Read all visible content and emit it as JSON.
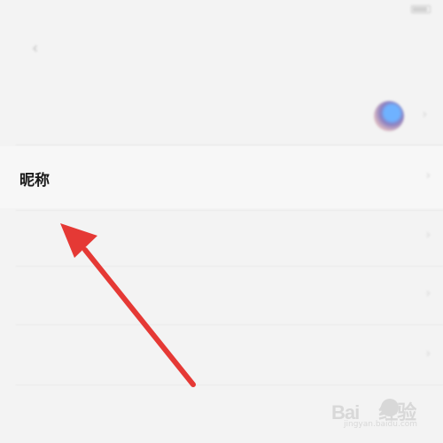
{
  "status_bar": {
    "carrier": "",
    "time": "",
    "battery_visible": true
  },
  "nav": {
    "title": "",
    "back_icon": "chevron-left-icon"
  },
  "profile": {
    "avatar_label": "",
    "nickname_label": "昵称",
    "nickname_value": "",
    "gender_label": "",
    "gender_value": "",
    "region_label": "",
    "region_value": "",
    "signature_label": "",
    "signature_value": "",
    "school_label": ""
  },
  "annotation": {
    "arrow_color": "#e53935",
    "arrow_target": "nickname-row"
  },
  "watermark": {
    "logo_text": "Bai",
    "logo_suffix": "经验",
    "subtext": "jingyan.baidu.com"
  }
}
